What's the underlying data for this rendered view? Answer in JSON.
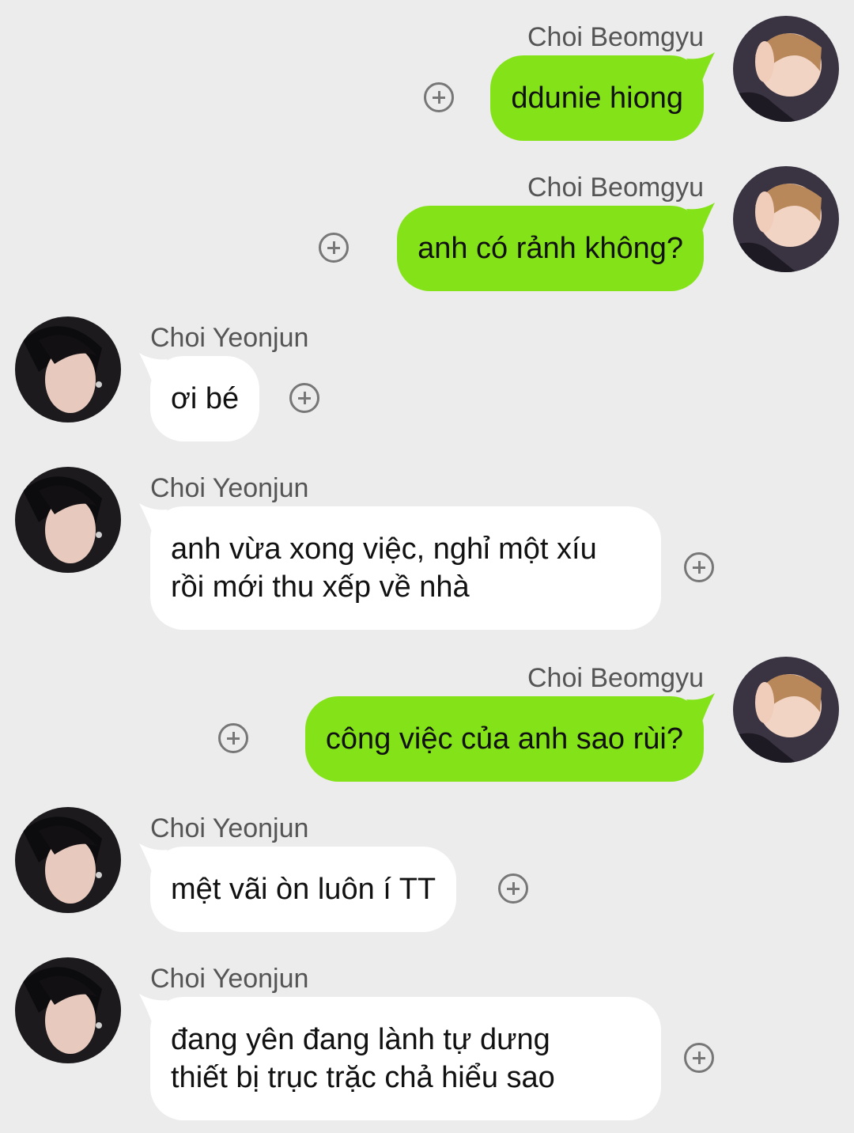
{
  "conversation": {
    "messages": [
      {
        "side": "right",
        "sender": "Choi Beomgyu",
        "lines": [
          "ddunie hiong"
        ]
      },
      {
        "side": "right",
        "sender": "Choi Beomgyu",
        "lines": [
          "anh có rảnh không?"
        ]
      },
      {
        "side": "left",
        "sender": "Choi Yeonjun",
        "lines": [
          "ơi bé"
        ]
      },
      {
        "side": "left",
        "sender": "Choi Yeonjun",
        "lines": [
          "anh vừa xong việc, nghỉ một xíu",
          "rồi mới thu xếp về nhà"
        ]
      },
      {
        "side": "right",
        "sender": "Choi Beomgyu",
        "lines": [
          "công việc của anh sao rùi?"
        ]
      },
      {
        "side": "left",
        "sender": "Choi Yeonjun",
        "lines": [
          "mệt vãi òn luôn í TT"
        ]
      },
      {
        "side": "left",
        "sender": "Choi Yeonjun",
        "lines": [
          "đang yên đang lành tự dưng",
          "thiết bị trục trặc chả hiểu sao"
        ]
      }
    ]
  },
  "colors": {
    "background": "#ececec",
    "outgoing_bubble": "#84e318",
    "incoming_bubble": "#ffffff",
    "sender_text": "#555555",
    "icon": "#777777"
  },
  "icons": {
    "add": "plus-circle-icon",
    "avatar_right": "avatar",
    "avatar_left": "avatar"
  }
}
